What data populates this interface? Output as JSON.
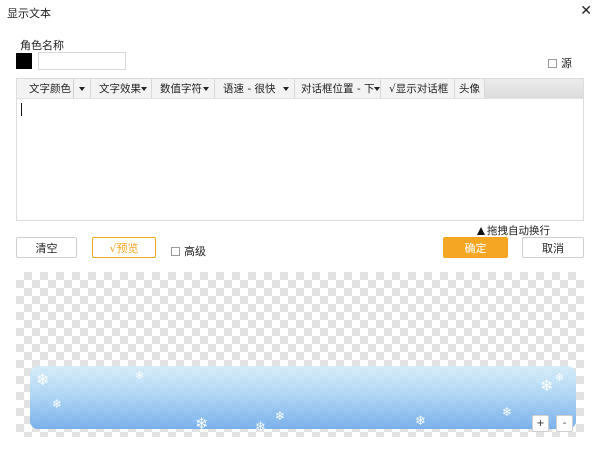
{
  "window": {
    "title": "显示文本",
    "close_glyph": "✕"
  },
  "character": {
    "name_label": "角色名称",
    "name_value": "",
    "swatch_color": "#000000"
  },
  "source": {
    "label": "源",
    "checked": false
  },
  "toolbar": {
    "items": [
      {
        "label": "文字颜色",
        "has_dropdown": true
      },
      {
        "label": "文字效果",
        "has_dropdown": true
      },
      {
        "label": "数值字符",
        "has_dropdown": true
      },
      {
        "label": "语速 - 很快",
        "has_dropdown": true
      },
      {
        "label": "对话框位置 - 下",
        "has_dropdown": true
      },
      {
        "label": "√显示对话框",
        "has_dropdown": false
      },
      {
        "label": "头像",
        "has_dropdown": false
      }
    ]
  },
  "editor": {
    "text": ""
  },
  "hint": {
    "label": "拖拽自动换行",
    "icon": "up-triangle-icon"
  },
  "buttons": {
    "clear": "清空",
    "preview": "√预览",
    "ok": "确定",
    "cancel": "取消"
  },
  "advanced": {
    "label": "高级",
    "checked": false
  },
  "zoom": {
    "plus": "+",
    "minus": "-"
  },
  "colors": {
    "accent": "#f5a623",
    "dialog_top": "#d2ecfa",
    "dialog_bottom": "#6eaaeb"
  }
}
